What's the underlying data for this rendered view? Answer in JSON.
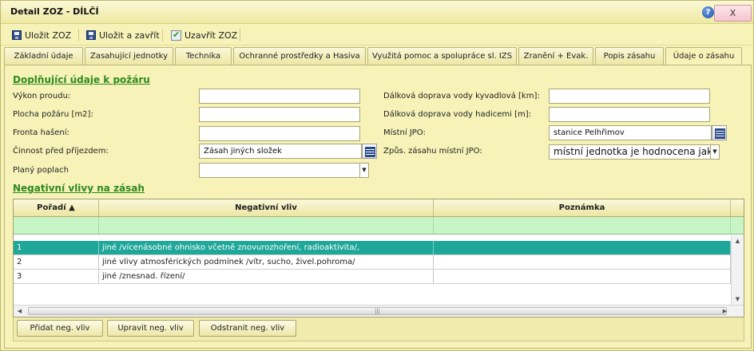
{
  "window": {
    "title": "Detail ZOZ - DÍLČÍ",
    "help_label": "?",
    "close_label": "X"
  },
  "toolbar": {
    "save_label": "Uložit ZOZ",
    "save_close_label": "Uložit a zavřít",
    "close_zoz_label": "Uzavřít ZOZ"
  },
  "tabs": [
    {
      "label": "Základní údaje"
    },
    {
      "label": "Zasahující jednotky"
    },
    {
      "label": "Technika"
    },
    {
      "label": "Ochranné prostředky a Hasiva"
    },
    {
      "label": "Využitá pomoc a spolupráce sl. IZS"
    },
    {
      "label": "Zranění + Evak."
    },
    {
      "label": "Popis zásahu"
    },
    {
      "label": "Údaje o zásahu",
      "active": true
    }
  ],
  "fire_section": {
    "title": "Doplňující údaje k požáru",
    "left_fields": [
      {
        "label": "Výkon proudu:",
        "value": ""
      },
      {
        "label": "Plocha požáru [m2]:",
        "value": ""
      },
      {
        "label": "Fronta hašení:",
        "value": ""
      },
      {
        "label": "Činnost před příjezdem:",
        "value": "Zásah jiných složek"
      },
      {
        "label": "Planý poplach",
        "value": ""
      }
    ],
    "right_fields": [
      {
        "label": "Dálková doprava vody kyvadlová [km]:",
        "value": ""
      },
      {
        "label": "Dálková doprava vody hadicemi [m]:",
        "value": ""
      },
      {
        "label": "Místní JPO:",
        "value": "stanice Pelhřimov"
      },
      {
        "label": "Způs. zásahu místní JPO:",
        "value": "místní jednotka je hodnocena jako p"
      }
    ]
  },
  "negative_section": {
    "title": "Negativní vlivy na zásah",
    "columns": [
      "Pořadí",
      "Negativní vliv",
      "Poznámka"
    ],
    "rows": [
      {
        "order": "1",
        "influence": "jiné /vícenásobné ohnisko včetně znovurozhoření, radioaktivita/,",
        "note": "",
        "selected": true
      },
      {
        "order": "2",
        "influence": "jiné vlivy atmosférických podmínek /vítr, sucho, živel.pohroma/",
        "note": ""
      },
      {
        "order": "3",
        "influence": "jiné /znesnad. řízení/",
        "note": ""
      }
    ],
    "buttons": {
      "add": "Přidat neg. vliv",
      "edit": "Upravit neg. vliv",
      "remove": "Odstranit neg. vliv"
    }
  }
}
